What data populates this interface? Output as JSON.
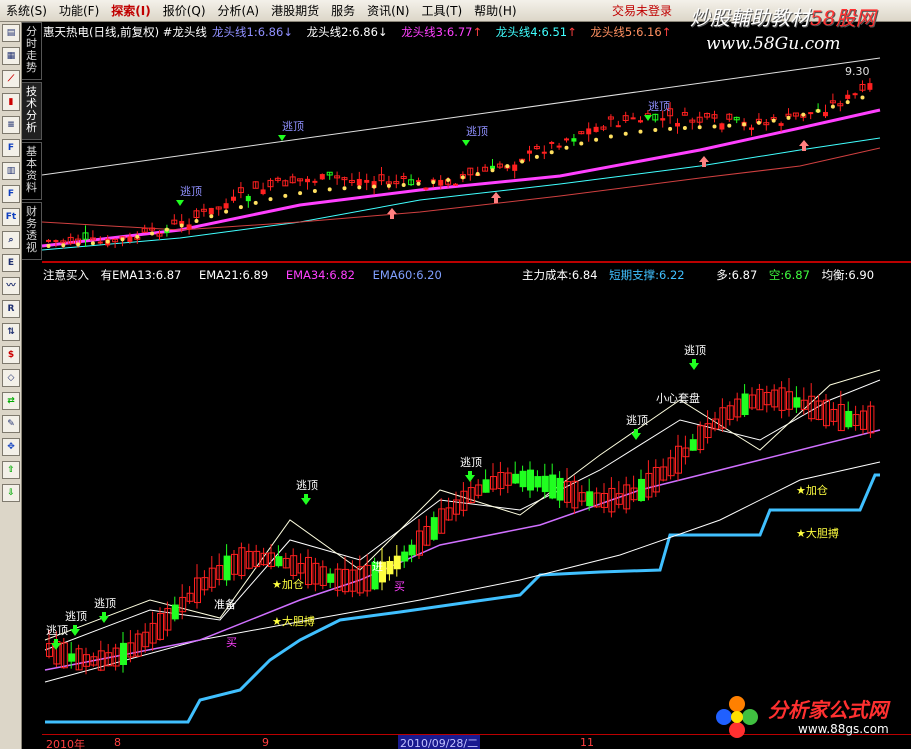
{
  "menu": {
    "items": [
      "系统(S)",
      "功能(F)",
      "探索(I)",
      "报价(Q)",
      "分析(A)",
      "港股期货",
      "服务",
      "资讯(N)",
      "工具(T)",
      "帮助(H)"
    ],
    "active_index": 2,
    "login_status": "交易未登录"
  },
  "watermark": {
    "top_text": "炒股輔助教材",
    "top_brand": "58股网",
    "top_url": "www.58Gu.com",
    "bottom_text": "分析家公式网",
    "bottom_url": "www.88gs.com"
  },
  "side_tabs": [
    "分时走势",
    "技术分析",
    "基本资料",
    "财务透视"
  ],
  "toolbar_icons": [
    "doc-icon",
    "grid-icon",
    "trend-icon",
    "bars-icon",
    "list-icon",
    "f10-icon",
    "report-icon",
    "f-icon",
    "ftable-icon",
    "search-icon",
    "eft-icon",
    "chart-icon",
    "rsi-icon",
    "sort-icon",
    "dollar-icon",
    "eraser-icon",
    "swap-icon",
    "pencil-icon",
    "move-icon",
    "up-arrow-icon",
    "down-arrow-icon"
  ],
  "upper_header": {
    "title": "惠天热电(日线,前复权)",
    "indicator": "#龙头线",
    "lines": [
      {
        "label": "龙头线1:6.86",
        "color": "#9090ff",
        "arrow": "↓"
      },
      {
        "label": "龙头线2:6.86",
        "color": "#ffffff",
        "arrow": "↓"
      },
      {
        "label": "龙头线3:6.77",
        "color": "#ff40ff",
        "arrow": "↑"
      },
      {
        "label": "龙头线4:6.51",
        "color": "#40ffff",
        "arrow": "↑"
      },
      {
        "label": "龙头线5:6.16",
        "color": "#ff9060",
        "arrow": "↑"
      }
    ],
    "price_marker": "9.30"
  },
  "lower_header": {
    "left": [
      {
        "label": "注意买入",
        "color": "#ffffff"
      },
      {
        "label": "有EMA13:6.87",
        "color": "#ffffff"
      },
      {
        "label": "EMA21:6.89",
        "color": "#ffffff"
      },
      {
        "label": "EMA34:6.82",
        "color": "#ff40ff"
      },
      {
        "label": "EMA60:6.20",
        "color": "#80a0ff"
      }
    ],
    "right": [
      {
        "label": "主力成本:6.84",
        "color": "#ffffff"
      },
      {
        "label": "短期支撑:6.22",
        "color": "#40c0ff"
      },
      {
        "label": "多:6.87",
        "color": "#ffffff"
      },
      {
        "label": "空:6.87",
        "color": "#40ff40"
      },
      {
        "label": "均衡:6.90",
        "color": "#ffffff"
      }
    ]
  },
  "annotations": {
    "escape": "逃顶",
    "prepare": "准备",
    "add": "★加仓",
    "bold_buy": "★大胆搏",
    "careful": "小心套盘",
    "buy": "买",
    "enter": "进"
  },
  "date_axis": {
    "labels": [
      "2010年",
      "8",
      "9",
      "2010/09/28/二",
      "11"
    ]
  },
  "chart_data": {
    "type": "candlestick",
    "x": [
      "2010年",
      "8",
      "9",
      "2010/09/28/二",
      "11"
    ],
    "price_max_label": 9.3,
    "series": [
      {
        "name": "龙头线1",
        "value": 6.86
      },
      {
        "name": "龙头线2",
        "value": 6.86
      },
      {
        "name": "龙头线3",
        "value": 6.77
      },
      {
        "name": "龙头线4",
        "value": 6.51
      },
      {
        "name": "龙头线5",
        "value": 6.16
      },
      {
        "name": "EMA13",
        "value": 6.87
      },
      {
        "name": "EMA21",
        "value": 6.89
      },
      {
        "name": "EMA34",
        "value": 6.82
      },
      {
        "name": "EMA60",
        "value": 6.2
      },
      {
        "name": "主力成本",
        "value": 6.84
      },
      {
        "name": "短期支撑",
        "value": 6.22
      },
      {
        "name": "多",
        "value": 6.87
      },
      {
        "name": "空",
        "value": 6.87
      },
      {
        "name": "均衡",
        "value": 6.9
      }
    ],
    "colors": {
      "up": "#ff2020",
      "down": "#20ff20",
      "line_purple": "#ff40ff",
      "line_cyan": "#40ffff",
      "line_blue": "#40c0ff",
      "background": "#000000"
    }
  }
}
